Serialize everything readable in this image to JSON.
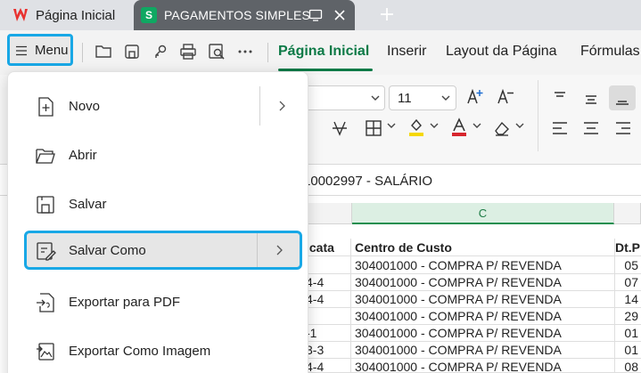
{
  "tabs": {
    "home_label": "Página Inicial",
    "doc_label": "PAGAMENTOS SIMPLES",
    "doc_logo_letter": "S"
  },
  "toolbar": {
    "menu_label": "Menu",
    "ribbon_tabs": [
      "Página Inicial",
      "Inserir",
      "Layout da Página",
      "Fórmulas"
    ],
    "font_size": "11"
  },
  "formula_bar": {
    "content": "10002997 - SALÁRIO"
  },
  "grid": {
    "columns": [
      {
        "name": "col-b",
        "label": ""
      },
      {
        "name": "col-c",
        "label": "C"
      },
      {
        "name": "col-d",
        "label": ""
      }
    ],
    "header": [
      "icata",
      "Centro de Custo",
      "Dt.P"
    ],
    "rows": [
      [
        "",
        "304001000 - COMPRA P/ REVENDA",
        "05"
      ],
      [
        "4-4",
        "304001000 - COMPRA P/ REVENDA",
        "07"
      ],
      [
        "4-4",
        "304001000 - COMPRA P/ REVENDA",
        "14"
      ],
      [
        "",
        "304001000 - COMPRA P/ REVENDA",
        "29"
      ],
      [
        "-1",
        "304001000 - COMPRA P/ REVENDA",
        "01"
      ],
      [
        "3-3",
        "304001000 - COMPRA P/ REVENDA",
        "01"
      ],
      [
        "4-4",
        "304001000 - COMPRA P/ REVENDA",
        "08"
      ]
    ]
  },
  "menu": {
    "items": [
      {
        "label": "Novo",
        "icon": "new-file-icon",
        "submenu": true
      },
      {
        "label": "Abrir",
        "icon": "folder-open-icon",
        "submenu": false
      },
      {
        "label": "Salvar",
        "icon": "save-icon",
        "submenu": false
      },
      {
        "label": "Salvar Como",
        "icon": "save-as-icon",
        "submenu": true,
        "highlighted": true
      },
      {
        "label": "Exportar para PDF",
        "icon": "export-pdf-icon",
        "submenu": false
      },
      {
        "label": "Exportar Como Imagem",
        "icon": "export-image-icon",
        "submenu": false
      }
    ]
  },
  "colors": {
    "highlight_border": "#19a8e6",
    "accent_green": "#0d7a47",
    "sheet_logo": "#0fa862",
    "wps_red": "#e8312f"
  }
}
